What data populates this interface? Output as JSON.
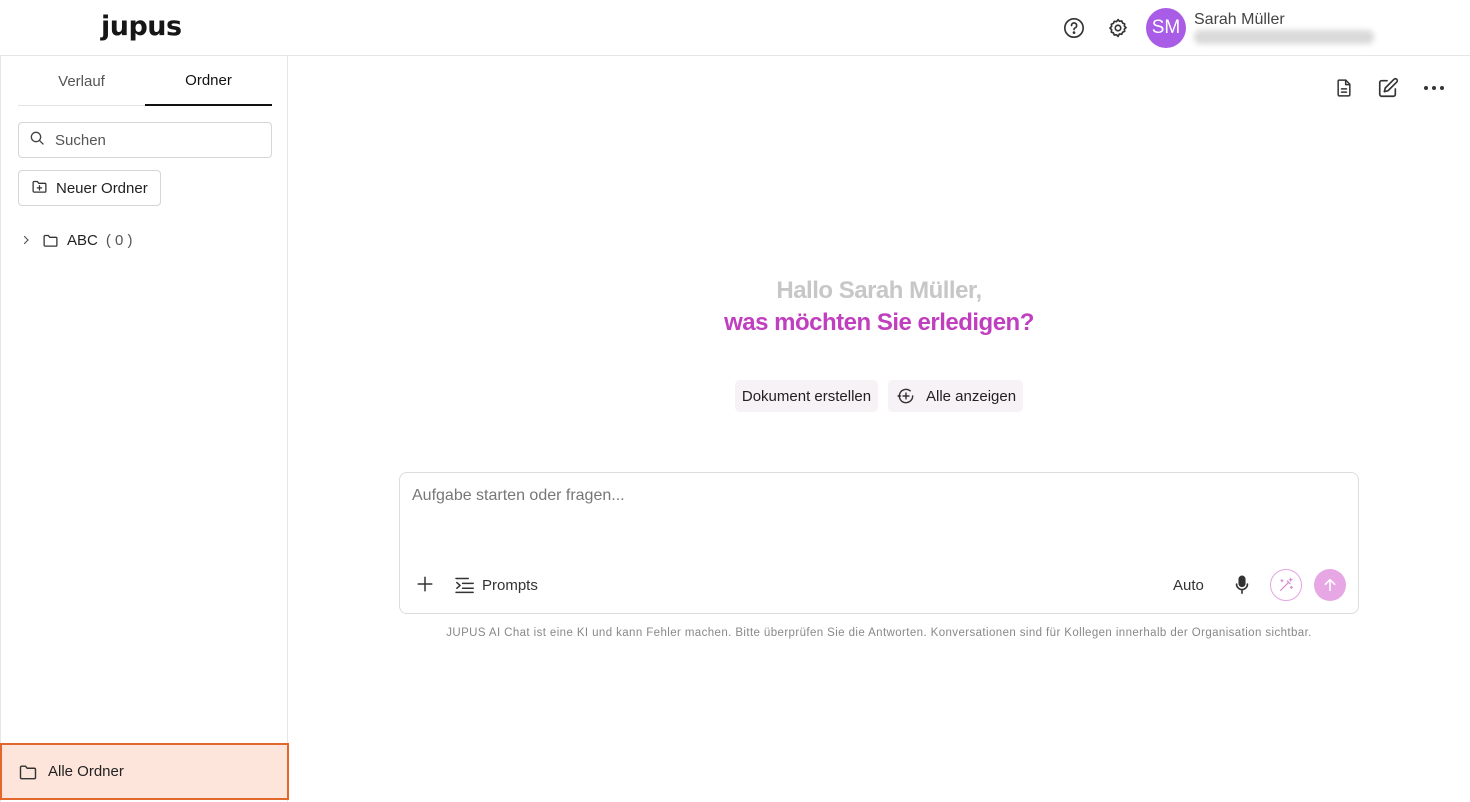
{
  "header": {
    "logo": "jupus",
    "user": {
      "initials": "SM",
      "name": "Sarah Müller"
    },
    "colors": {
      "avatar": "#a95de6"
    },
    "icons": [
      "help-icon",
      "settings-icon"
    ]
  },
  "sidebar": {
    "tabs": [
      {
        "label": "Verlauf",
        "active": false
      },
      {
        "label": "Ordner",
        "active": true
      }
    ],
    "search": {
      "placeholder": "Suchen",
      "value": ""
    },
    "new_folder_label": "Neuer Ordner",
    "folders": [
      {
        "name": "ABC",
        "count": "( 0 )"
      }
    ],
    "all_folders_label": "Alle Ordner",
    "colors": {
      "all_folders_bg": "#fde5dc",
      "all_folders_border": "#e2672b"
    }
  },
  "main": {
    "toolbar_icons": [
      "document-icon",
      "edit-icon",
      "more-icon"
    ],
    "greeting": "Hallo Sarah Müller,",
    "subgreeting": "was möchten Sie erledigen?",
    "chips": {
      "create_document": "Dokument erstellen",
      "show_all": "Alle anzeigen"
    },
    "chat": {
      "placeholder": "Aufgabe starten oder fragen...",
      "value": "",
      "prompts_label": "Prompts",
      "model_label": "Auto"
    },
    "disclaimer": "JUPUS AI Chat ist eine KI und kann Fehler machen. Bitte überprüfen Sie die Antworten. Konversationen sind für Kollegen innerhalb der Organisation sichtbar.",
    "colors": {
      "accent": "#c03fbf",
      "greeting_gray": "#c7c7c7",
      "send_button": "#e7a7e4"
    }
  }
}
